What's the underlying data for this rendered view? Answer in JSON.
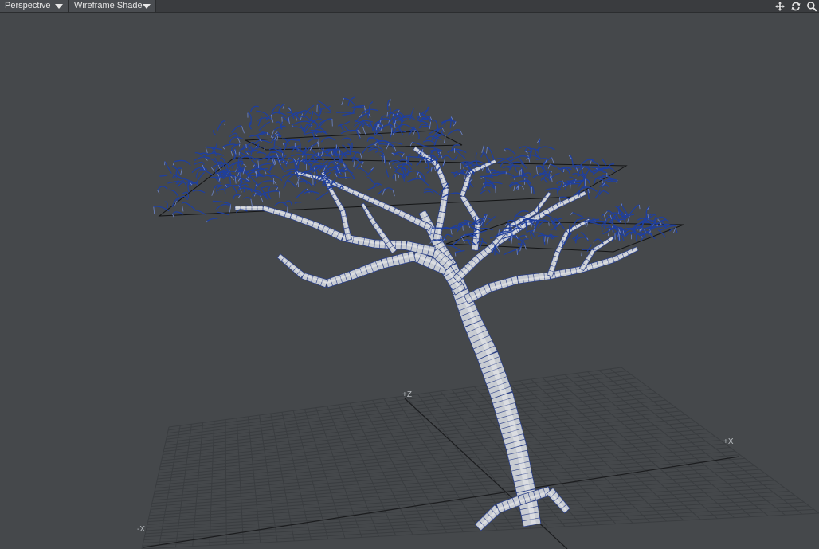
{
  "viewport": {
    "view_mode": "Perspective",
    "shading_mode": "Wireframe Shade"
  },
  "toolbar": {
    "tools": [
      {
        "name": "move-view-icon"
      },
      {
        "name": "rotate-view-icon"
      },
      {
        "name": "zoom-view-icon"
      }
    ]
  },
  "grid": {
    "axis_z_pos": "+Z",
    "axis_x_pos": "+X",
    "axis_x_neg": "-X"
  },
  "colors": {
    "background": "#45484b",
    "grid": "#3a3d40",
    "trunk": "#c8ccd2",
    "wire": "#1f3f9e"
  }
}
